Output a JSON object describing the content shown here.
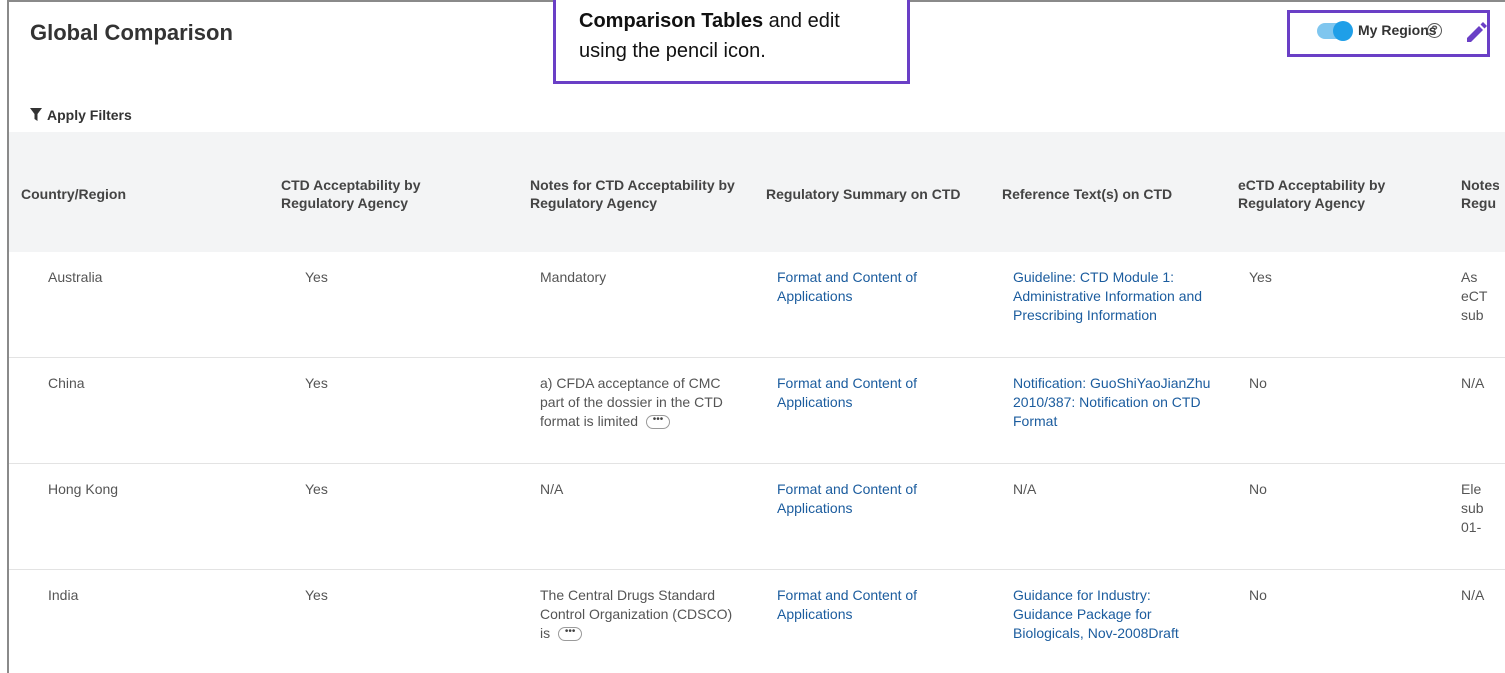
{
  "header": {
    "title": "Global Comparison",
    "callout_bold": "Comparison Tables",
    "callout_rest": " and edit",
    "callout_line2": "using the pencil icon.",
    "regions_label": "My Regions",
    "help_glyph": "?"
  },
  "filters": {
    "label": "Apply Filters"
  },
  "columns": [
    "Country/Region",
    "CTD Acceptability by Regulatory Agency",
    "Notes for CTD Acceptability by Regulatory Agency",
    "Regulatory Summary on CTD",
    "Reference Text(s) on CTD",
    "eCTD Acceptability by Regulatory Agency",
    "Notes for eCTD Acceptability by Regu"
  ],
  "rows": [
    {
      "country": "Australia",
      "ctd": "Yes",
      "notes": "Mandatory",
      "summary": "Format and Content of Applications",
      "reference": "Guideline: CTD Module 1: Administrative Information and Prescribing Information",
      "ectd": "Yes",
      "ectd_notes": "As eCT sub"
    },
    {
      "country": "China",
      "ctd": "Yes",
      "notes": "a) CFDA acceptance of CMC part of the dossier in the CTD format is limited",
      "summary": "Format and Content of Applications",
      "reference": "Notification: GuoShiYaoJianZhu 2010/387: Notification on CTD Format",
      "ectd": "No",
      "ectd_notes": "N/A"
    },
    {
      "country": "Hong Kong",
      "ctd": "Yes",
      "notes": "N/A",
      "summary": "Format and Content of Applications",
      "reference": "N/A",
      "ectd": "No",
      "ectd_notes": "Ele sub 01-"
    },
    {
      "country": "India",
      "ctd": "Yes",
      "notes": "The Central Drugs Standard Control Organization (CDSCO) is",
      "summary": "Format and Content of Applications",
      "reference": "Guidance for Industry: Guidance Package for Biologicals, Nov-2008Draft",
      "ectd": "No",
      "ectd_notes": "N/A"
    }
  ],
  "more_glyph": "•••",
  "colors": {
    "accent_purple": "#6a3fc6",
    "toggle_blue": "#1f9fe8",
    "link_blue": "#1b5c9e",
    "header_bg": "#f3f4f5"
  },
  "icons": [
    "filter-icon",
    "pencil-icon",
    "help-icon"
  ]
}
